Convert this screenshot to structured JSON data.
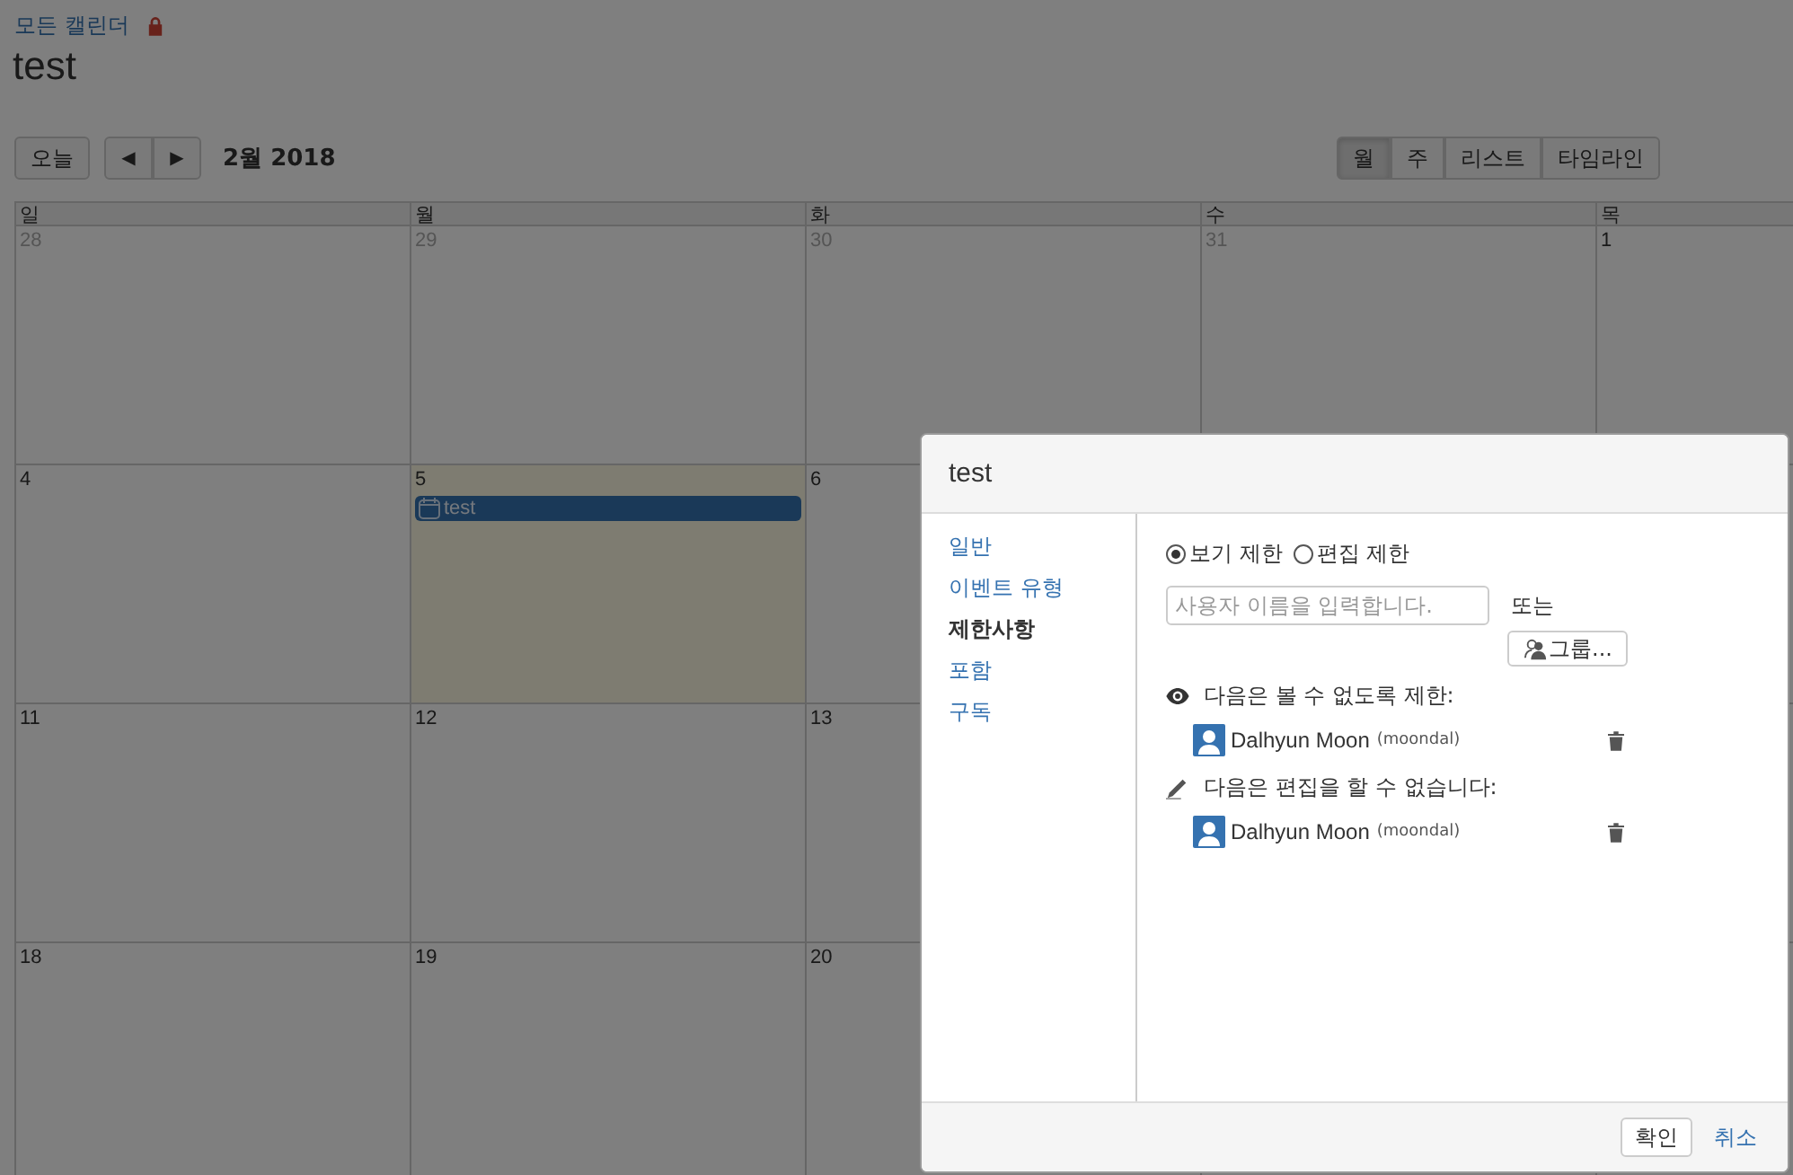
{
  "breadcrumb": {
    "link": "모든 캘린더"
  },
  "calendar_title": "test",
  "toolbar": {
    "today": "오늘",
    "prev": "◀",
    "next": "▶",
    "period": "2월 2018",
    "views": [
      {
        "label": "월",
        "selected": true
      },
      {
        "label": "주",
        "selected": false
      },
      {
        "label": "리스트",
        "selected": false
      },
      {
        "label": "타임라인",
        "selected": false
      }
    ]
  },
  "weekdays": [
    "일",
    "월",
    "화",
    "수",
    "목"
  ],
  "weeks": [
    {
      "days": [
        {
          "number": "28",
          "other_month": true,
          "today": false
        },
        {
          "number": "29",
          "other_month": true,
          "today": false
        },
        {
          "number": "30",
          "other_month": true,
          "today": false
        },
        {
          "number": "31",
          "other_month": true,
          "today": false
        },
        {
          "number": "1",
          "other_month": false,
          "today": false
        }
      ]
    },
    {
      "days": [
        {
          "number": "4",
          "other_month": false,
          "today": false
        },
        {
          "number": "5",
          "other_month": false,
          "today": true,
          "events": [
            {
              "title": "test"
            }
          ]
        },
        {
          "number": "6",
          "other_month": false,
          "today": false
        }
      ]
    },
    {
      "days": [
        {
          "number": "11",
          "other_month": false,
          "today": false
        },
        {
          "number": "12",
          "other_month": false,
          "today": false
        },
        {
          "number": "13",
          "other_month": false,
          "today": false
        }
      ]
    },
    {
      "days": [
        {
          "number": "18",
          "other_month": false,
          "today": false
        },
        {
          "number": "19",
          "other_month": false,
          "today": false
        },
        {
          "number": "20",
          "other_month": false,
          "today": false
        }
      ]
    }
  ],
  "dialog": {
    "title": "test",
    "nav": [
      {
        "label": "일반",
        "selected": false
      },
      {
        "label": "이벤트 유형",
        "selected": false
      },
      {
        "label": "제한사항",
        "selected": true
      },
      {
        "label": "포함",
        "selected": false
      },
      {
        "label": "구독",
        "selected": false
      }
    ],
    "modes": [
      {
        "label": "보기 제한",
        "selected": true
      },
      {
        "label": "편집 제한",
        "selected": false
      }
    ],
    "user_field": {
      "placeholder": "사용자 이름을 입력합니다."
    },
    "or_text": "또는",
    "group_button": "그룹...",
    "sections": [
      {
        "kind": "view",
        "heading": "다음은 볼 수 없도록 제한:",
        "users": [
          {
            "name": "Dalhyun Moon",
            "username": "(moondal)"
          }
        ]
      },
      {
        "kind": "edit",
        "heading": "다음은 편집을 할 수 없습니다:",
        "users": [
          {
            "name": "Dalhyun Moon",
            "username": "(moondal)"
          }
        ]
      }
    ],
    "ok": "확인",
    "cancel": "취소"
  }
}
